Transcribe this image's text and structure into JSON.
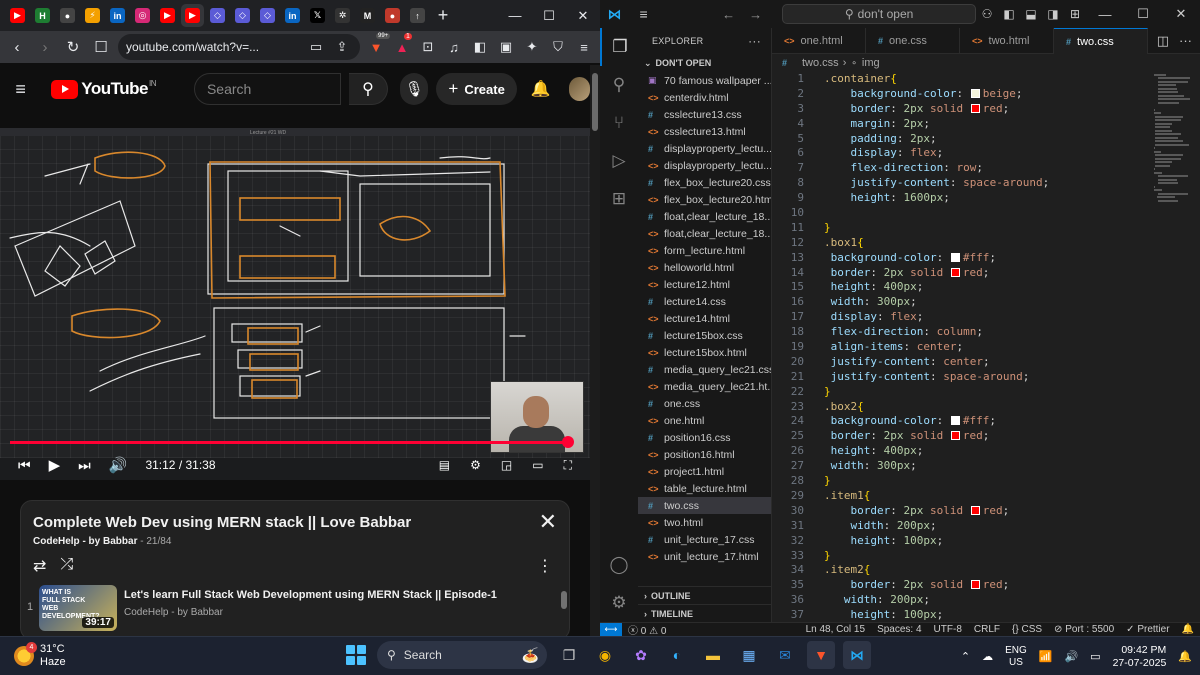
{
  "browser": {
    "tabs": [
      {
        "icon": "youtube-icon",
        "color": "#ff0000",
        "glyph": "▶"
      },
      {
        "icon": "app-icon",
        "color": "#1e7d32",
        "glyph": "H"
      },
      {
        "icon": "github-icon",
        "color": "#444444",
        "glyph": "●"
      },
      {
        "icon": "bolt-icon",
        "color": "#f4a000",
        "glyph": "⚡"
      },
      {
        "icon": "linkedin-icon",
        "color": "#0a66c2",
        "glyph": "in"
      },
      {
        "icon": "instagram-icon",
        "color": "#d62976",
        "glyph": "◎"
      },
      {
        "icon": "youtube-icon",
        "color": "#ff0000",
        "glyph": "▶"
      },
      {
        "icon": "youtube-icon",
        "color": "#ff0000",
        "glyph": "▶",
        "active": true
      },
      {
        "icon": "code-icon",
        "color": "#5b5bd6",
        "glyph": "◇"
      },
      {
        "icon": "code-icon",
        "color": "#5b5bd6",
        "glyph": "◇"
      },
      {
        "icon": "code-icon",
        "color": "#5b5bd6",
        "glyph": "◇"
      },
      {
        "icon": "linkedin-icon",
        "color": "#0a66c2",
        "glyph": "in"
      },
      {
        "icon": "x-icon",
        "color": "#000000",
        "glyph": "𝕏"
      },
      {
        "icon": "openai-icon",
        "color": "#333333",
        "glyph": "✲"
      },
      {
        "icon": "medium-icon",
        "color": "#222222",
        "glyph": "M"
      },
      {
        "icon": "record-icon",
        "color": "#c0392b",
        "glyph": "●"
      },
      {
        "icon": "arrow-icon",
        "color": "#444444",
        "glyph": "↑"
      }
    ],
    "url": "youtube.com/watch?v=...",
    "shields_badge": "99+",
    "alert_badge": "1"
  },
  "youtube": {
    "logo_text": "YouTube",
    "region": "IN",
    "search_placeholder": "Search",
    "create_label": "Create",
    "time_current": "31:12",
    "time_separator": " / ",
    "time_total": "31:38",
    "playback_progress": 0.986,
    "slide_header": "Lecture #21 WD"
  },
  "playlist": {
    "title": "Complete Web Dev using MERN stack || Love Babbar",
    "channel": "CodeHelp - by Babbar",
    "position": " - 21/84",
    "items": [
      {
        "index": "1",
        "title": "Let's learn Full Stack Web Development using MERN Stack || Episode-1",
        "channel": "CodeHelp - by Babbar",
        "duration": "39:17",
        "thumb_text": "WHAT IS FULL STACK WEB DEVELOPMENT?"
      }
    ]
  },
  "vscode": {
    "search": "don't open",
    "explorer_title": "EXPLORER",
    "section": "DON'T OPEN",
    "files": [
      {
        "name": "70 famous wallpaper ...",
        "type": "img"
      },
      {
        "name": "centerdiv.html",
        "type": "html"
      },
      {
        "name": "csslecture13.css",
        "type": "css"
      },
      {
        "name": "csslecture13.html",
        "type": "html"
      },
      {
        "name": "displayproperty_lectu...",
        "type": "css"
      },
      {
        "name": "displayproperty_lectu...",
        "type": "html"
      },
      {
        "name": "flex_box_lecture20.css",
        "type": "css"
      },
      {
        "name": "flex_box_lecture20.html",
        "type": "html"
      },
      {
        "name": "float,clear_lecture_18....",
        "type": "css"
      },
      {
        "name": "float,clear_lecture_18....",
        "type": "html"
      },
      {
        "name": "form_lecture.html",
        "type": "html"
      },
      {
        "name": "helloworld.html",
        "type": "html"
      },
      {
        "name": "lecture12.html",
        "type": "html"
      },
      {
        "name": "lecture14.css",
        "type": "css"
      },
      {
        "name": "lecture14.html",
        "type": "html"
      },
      {
        "name": "lecture15box.css",
        "type": "css"
      },
      {
        "name": "lecture15box.html",
        "type": "html"
      },
      {
        "name": "media_query_lec21.css",
        "type": "css"
      },
      {
        "name": "media_query_lec21.ht...",
        "type": "html"
      },
      {
        "name": "one.css",
        "type": "css"
      },
      {
        "name": "one.html",
        "type": "html"
      },
      {
        "name": "position16.css",
        "type": "css"
      },
      {
        "name": "position16.html",
        "type": "html"
      },
      {
        "name": "project1.html",
        "type": "html"
      },
      {
        "name": "table_lecture.html",
        "type": "html"
      },
      {
        "name": "two.css",
        "type": "css",
        "selected": true
      },
      {
        "name": "two.html",
        "type": "html"
      },
      {
        "name": "unit_lecture_17.css",
        "type": "css"
      },
      {
        "name": "unit_lecture_17.html",
        "type": "html"
      }
    ],
    "outline": "OUTLINE",
    "timeline": "TIMELINE",
    "tabs": [
      {
        "name": "one.html",
        "type": "html"
      },
      {
        "name": "one.css",
        "type": "css"
      },
      {
        "name": "two.html",
        "type": "html"
      },
      {
        "name": "two.css",
        "type": "css",
        "active": true
      }
    ],
    "breadcrumb": [
      "two.css",
      "img"
    ],
    "code": [
      ".container{",
      "    background-color: ■beige;",
      "    border: 2px solid ■red;",
      "    margin: 2px;",
      "    padding: 2px;",
      "    display: flex;",
      "    flex-direction: row;",
      "    justify-content: space-around;",
      "    height: 1600px;",
      "",
      "}",
      ".box1{",
      " background-color: ■#fff;",
      " border: 2px solid ■red;",
      " height: 400px;",
      " width: 300px;",
      " display: flex;",
      " flex-direction: column;",
      " align-items: center;",
      " justify-content: center;",
      " justify-content: space-around;",
      "}",
      ".box2{",
      " background-color: ■#fff;",
      " border: 2px solid ■red;",
      " height: 400px;",
      " width: 300px;",
      "}",
      ".item1{",
      "    border: 2px solid ■red;",
      "    width: 200px;",
      "    height: 100px;",
      "}",
      ".item2{",
      "    border: 2px solid ■red;",
      "   width: 200px;",
      "    height: 100px;"
    ],
    "status": {
      "errors": "0",
      "warnings": "0",
      "position": "Ln 48, Col 15",
      "spaces": "Spaces: 4",
      "encoding": "UTF-8",
      "eol": "CRLF",
      "language": "CSS",
      "port": "Port : 5500",
      "formatter": "Prettier"
    }
  },
  "taskbar": {
    "weather_temp": "31°C",
    "weather_desc": "Haze",
    "weather_badge": "4",
    "search_label": "Search",
    "lang": "ENG",
    "region": "US",
    "time": "09:42 PM",
    "date": "27-07-2025"
  }
}
